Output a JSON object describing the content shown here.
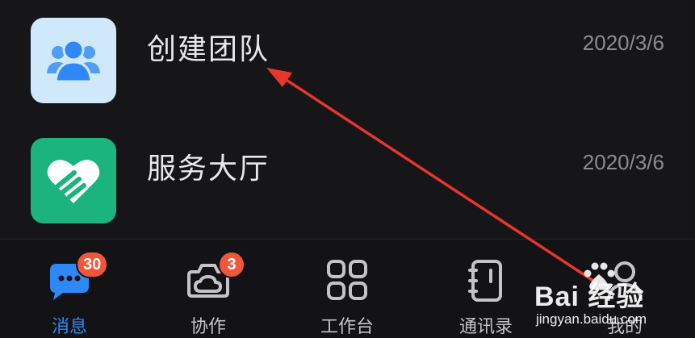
{
  "list": {
    "items": [
      {
        "title": "创建团队",
        "date": "2020/3/6",
        "icon": "team-icon"
      },
      {
        "title": "服务大厅",
        "date": "2020/3/6",
        "icon": "heart-hand-icon"
      }
    ]
  },
  "tabbar": {
    "tabs": [
      {
        "label": "消息",
        "icon": "chat-bubble-icon",
        "badge": "30",
        "active": true
      },
      {
        "label": "协作",
        "icon": "collaboration-icon",
        "badge": "3",
        "active": false
      },
      {
        "label": "工作台",
        "icon": "grid-icon",
        "badge": "",
        "active": false
      },
      {
        "label": "通讯录",
        "icon": "contacts-book-icon",
        "badge": "",
        "active": false
      },
      {
        "label": "我的",
        "icon": "user-icon",
        "badge": "",
        "active": false
      }
    ]
  },
  "watermark": {
    "brand": "Bai 经验",
    "url": "jingyan.baidu.com"
  },
  "colors": {
    "accent": "#2f88f6",
    "badge": "#f2563a",
    "arrow": "#e8352e",
    "background": "#161618"
  }
}
